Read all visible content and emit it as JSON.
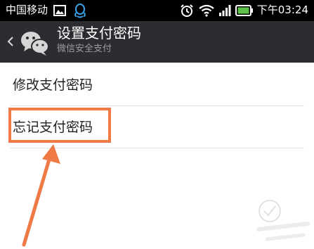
{
  "status_bar": {
    "carrier": "中国移动",
    "time": "下午03:24",
    "icons": [
      "image-icon",
      "qq-icon",
      "alarm-icon",
      "wifi-icon",
      "signal-icon",
      "battery-icon"
    ]
  },
  "action_bar": {
    "title": "设置支付密码",
    "subtitle": "微信安全支付",
    "icons": [
      "back-chevron-icon",
      "wechat-logo-icon"
    ]
  },
  "menu": {
    "items": [
      {
        "label": "修改支付密码"
      },
      {
        "label": "忘记支付密码"
      }
    ]
  },
  "annotation": {
    "highlight_color": "#f07a45"
  },
  "colors": {
    "status_bar_bg": "#000000",
    "action_bar_bg": "#2c2d31",
    "subtitle_text": "#9a9ca0",
    "battery_green": "#5ec24a"
  }
}
